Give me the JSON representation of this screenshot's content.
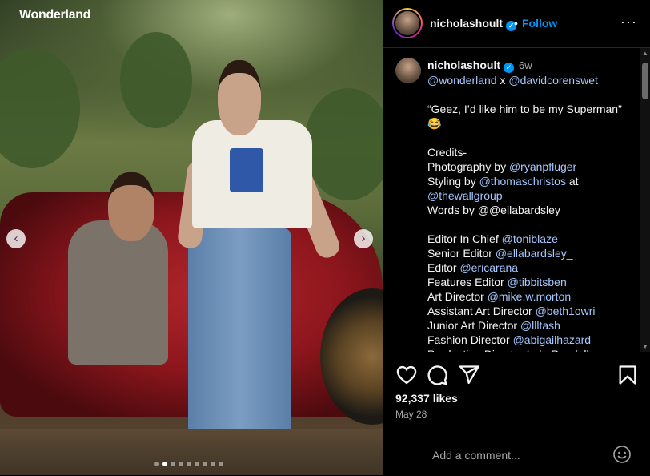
{
  "post_image": {
    "brand": "Wonderland",
    "nav_prev": "‹",
    "nav_next": "›",
    "carousel_count": 9,
    "carousel_active_index": 1
  },
  "header": {
    "username": "nicholashoult",
    "separator": "•",
    "follow_label": "Follow",
    "more_label": "···"
  },
  "caption": {
    "username": "nicholashoult",
    "time": "6w",
    "lines": [
      {
        "parts": [
          {
            "t": "@wonderland",
            "m": true
          },
          {
            "t": " x ",
            "m": false
          },
          {
            "t": "@davidcorenswet",
            "m": true
          }
        ]
      },
      {
        "gap": true
      },
      {
        "parts": [
          {
            "t": "“Geez, I’d like him to be my Superman”",
            "m": false
          }
        ]
      },
      {
        "parts": [
          {
            "t": "😂",
            "m": false
          }
        ]
      },
      {
        "gap": true
      },
      {
        "parts": [
          {
            "t": "Credits-",
            "m": false
          }
        ]
      },
      {
        "parts": [
          {
            "t": "Photography by ",
            "m": false
          },
          {
            "t": "@ryanpfluger",
            "m": true
          }
        ]
      },
      {
        "parts": [
          {
            "t": "Styling by ",
            "m": false
          },
          {
            "t": "@thomaschristos",
            "m": true
          },
          {
            "t": " at",
            "m": false
          }
        ]
      },
      {
        "parts": [
          {
            "t": "@thewallgroup",
            "m": true
          }
        ]
      },
      {
        "parts": [
          {
            "t": "Words by @@ellabardsley_",
            "m": false
          }
        ]
      },
      {
        "gap": true
      },
      {
        "parts": [
          {
            "t": "Editor In Chief ",
            "m": false
          },
          {
            "t": "@toniblaze",
            "m": true
          }
        ]
      },
      {
        "parts": [
          {
            "t": "Senior Editor ",
            "m": false
          },
          {
            "t": "@ellabardsley_",
            "m": true
          }
        ]
      },
      {
        "parts": [
          {
            "t": "Editor ",
            "m": false
          },
          {
            "t": "@ericarana",
            "m": true
          }
        ]
      },
      {
        "parts": [
          {
            "t": "Features Editor ",
            "m": false
          },
          {
            "t": "@tibbitsben",
            "m": true
          }
        ]
      },
      {
        "parts": [
          {
            "t": "Art Director ",
            "m": false
          },
          {
            "t": "@mike.w.morton",
            "m": true
          }
        ]
      },
      {
        "parts": [
          {
            "t": "Assistant Art Director ",
            "m": false
          },
          {
            "t": "@beth1owri",
            "m": true
          }
        ]
      },
      {
        "parts": [
          {
            "t": "Junior Art Director ",
            "m": false
          },
          {
            "t": "@llltash",
            "m": true
          }
        ]
      },
      {
        "parts": [
          {
            "t": "Fashion Director ",
            "m": false
          },
          {
            "t": "@abigailhazard",
            "m": true
          }
        ]
      },
      {
        "parts": [
          {
            "t": "Production Director Lola Randall",
            "m": false
          }
        ]
      }
    ]
  },
  "scrollbar": {
    "up": "▲",
    "down": "▼"
  },
  "actions": {
    "likes": "92,337 likes",
    "date": "May 28"
  },
  "comment": {
    "placeholder": "Add a comment..."
  },
  "colors": {
    "link": "#0095f6",
    "mention": "#a4c8ff",
    "muted": "#a8a8a8"
  }
}
